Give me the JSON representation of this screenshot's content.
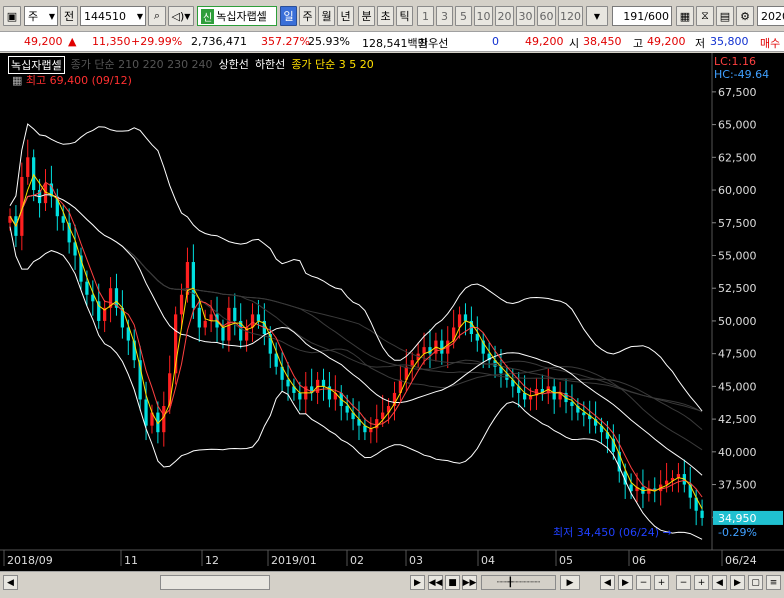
{
  "toolbar": {
    "market": "주",
    "period_type": "전",
    "code": "144510",
    "stock_name": "녹십자랩셀",
    "sin_badge": "신",
    "periods": [
      "일",
      "주",
      "월",
      "년",
      "분",
      "초",
      "틱"
    ],
    "active_period": "일",
    "intervals": [
      "1",
      "3",
      "5",
      "10",
      "20",
      "30",
      "60",
      "120"
    ],
    "count_value": "191",
    "count_total": "/600",
    "date_value": "2020"
  },
  "info": {
    "price": "49,200",
    "change": "11,350",
    "change_pct": "+29.99%",
    "volume": "2,736,471",
    "volume_ratio": "357.27%",
    "turnover": "25.93%",
    "amount": "128,541백만",
    "priority_label": "최우선",
    "priority_value": "0",
    "last_price": "49,200",
    "open_label": "시",
    "open": "38,450",
    "high_label": "고",
    "high": "49,200",
    "low_label": "저",
    "low": "35,800",
    "tail": "매수"
  },
  "legend": {
    "name": "녹십자랩셀",
    "ma_long": "종가 단순 210 220 230 240",
    "upper": "상한선",
    "lower": "하한선",
    "ma_short": "종가 단순 3 5 20"
  },
  "right_labels": {
    "lc": "LC:1.16",
    "hc": "HC:-49.64",
    "current_price": "34,950",
    "current_pct": "-0.29%"
  },
  "annotations": {
    "max": "최고 69,400 (09/12)",
    "min": "최저 34,450 (06/24)"
  },
  "x_labels": [
    "2018/09",
    "11",
    "12",
    "2019/01",
    "02",
    "03",
    "04",
    "05",
    "06",
    "06/24"
  ],
  "colors": {
    "up": "#ff2020",
    "down": "#00e0e0",
    "ma3": "#ffe000",
    "ma5": "#ff4040",
    "ma20": "#ffffff",
    "band": "#ffffff",
    "bg": "#000000"
  },
  "chart_data": {
    "type": "candlestick",
    "ylim": [
      32500,
      69400
    ],
    "y_ticks": [
      "67,500",
      "65,000",
      "62,500",
      "60,000",
      "57,500",
      "55,000",
      "52,500",
      "50,000",
      "47,500",
      "45,000",
      "42,500",
      "40,000",
      "37,500",
      "35,000"
    ],
    "series": [
      {
        "name": "종가",
        "values": [
          58000,
          56500,
          61000,
          62500,
          60000,
          59000,
          60500,
          59500,
          58000,
          57500,
          56000,
          55000,
          53000,
          52000,
          51500,
          50000,
          51000,
          52500,
          51000,
          49500,
          48500,
          47000,
          44000,
          42000,
          43000,
          41500,
          43500,
          46000,
          50500,
          52000,
          54500,
          51000,
          49500,
          50000,
          50500,
          49500,
          48500,
          51000,
          50000,
          48500,
          49500,
          50500,
          50000,
          49000,
          47500,
          46500,
          45500,
          45000,
          44500,
          44000,
          45000,
          44500,
          45500,
          45000,
          44000,
          44500,
          43500,
          43000,
          42500,
          42000,
          41500,
          41800,
          42500,
          43000,
          43500,
          44500,
          45500,
          46500,
          47000,
          47500,
          48000,
          47500,
          48500,
          47500,
          48500,
          49500,
          50500,
          50000,
          49000,
          48500,
          47500,
          47000,
          46500,
          46000,
          45500,
          45000,
          44500,
          44000,
          44300,
          44800,
          44500,
          45000,
          44000,
          44500,
          43800,
          43500,
          43000,
          42800,
          42500,
          42000,
          41500,
          41000,
          40000,
          38500,
          37500,
          37000,
          37300,
          36800,
          37200,
          37000,
          37500,
          37800,
          38000,
          38300,
          37500,
          36500,
          35500,
          34950
        ]
      }
    ]
  }
}
